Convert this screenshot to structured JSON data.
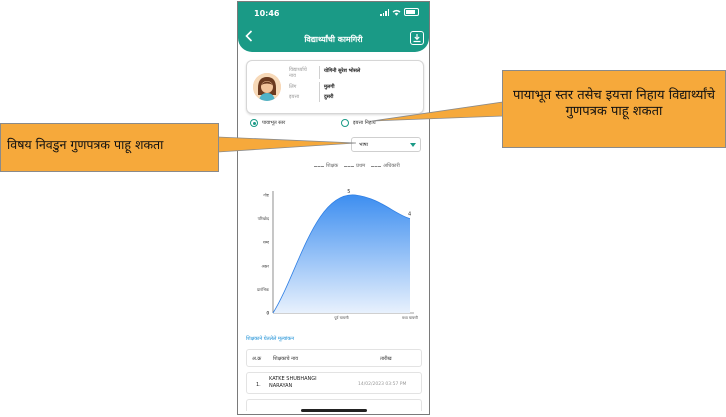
{
  "status": {
    "time": "10:46"
  },
  "appbar": {
    "title": "विद्यार्थ्यांची कामगिरी"
  },
  "student": {
    "name_label": "विद्यार्थ्याचे नाव",
    "name_value": "योगिनी सुरेश भोसले",
    "gender_label": "लिंग",
    "gender_value": "मुलगी",
    "class_label": "इयत्ता",
    "class_value": "दुसरी"
  },
  "radios": {
    "option1": "पायाभूत स्तर",
    "option2": "इयत्ता निहाय",
    "selected": "option1"
  },
  "subject": {
    "label": "विषय",
    "value": "भाषा"
  },
  "legend": {
    "teacher": "शिक्षक",
    "first": "प्रथम",
    "officer": "अधिकारी"
  },
  "chart_data": {
    "type": "area",
    "y_levels": [
      "0",
      "प्रारंभिक",
      "अक्षर",
      "शब्द",
      "परिच्छेद",
      "गोष्ट"
    ],
    "x_ticks": [
      "पूर्व चाचणी",
      "मध्य चाचणी"
    ],
    "x_origin_label": "0",
    "series": [
      {
        "points": [
          {
            "x": 0,
            "y": 0
          },
          {
            "x": 1.2,
            "y": 5
          },
          {
            "x": 2,
            "y": 4
          }
        ]
      }
    ],
    "labels": [
      "5",
      "4"
    ],
    "fill_top": "#3d8ef0",
    "fill_bottom": "#e8f1fd",
    "ylim": [
      0,
      5
    ]
  },
  "evaluation": {
    "title": "शिक्षकाने घेतलेले मूल्यांकन",
    "headers": [
      "अ.क्र",
      "शिक्षकाचे नाव",
      "तारीख"
    ],
    "rows": [
      {
        "no": "1.",
        "name": "KATKE SHUBHANGI NARAYAN",
        "date": "14/02/2023 03:57 PM"
      }
    ]
  },
  "callouts": {
    "left": "विषय निवडुन गुणपत्रक पाहू शकता",
    "right": "पायाभूत स्तर तसेच इयत्ता निहाय विद्यार्थ्यांचे गुणपत्रक पाहू शकता",
    "fill": "#f6a93b"
  },
  "theme": {
    "primary": "#1a9a86",
    "link": "#1a8fd6"
  }
}
